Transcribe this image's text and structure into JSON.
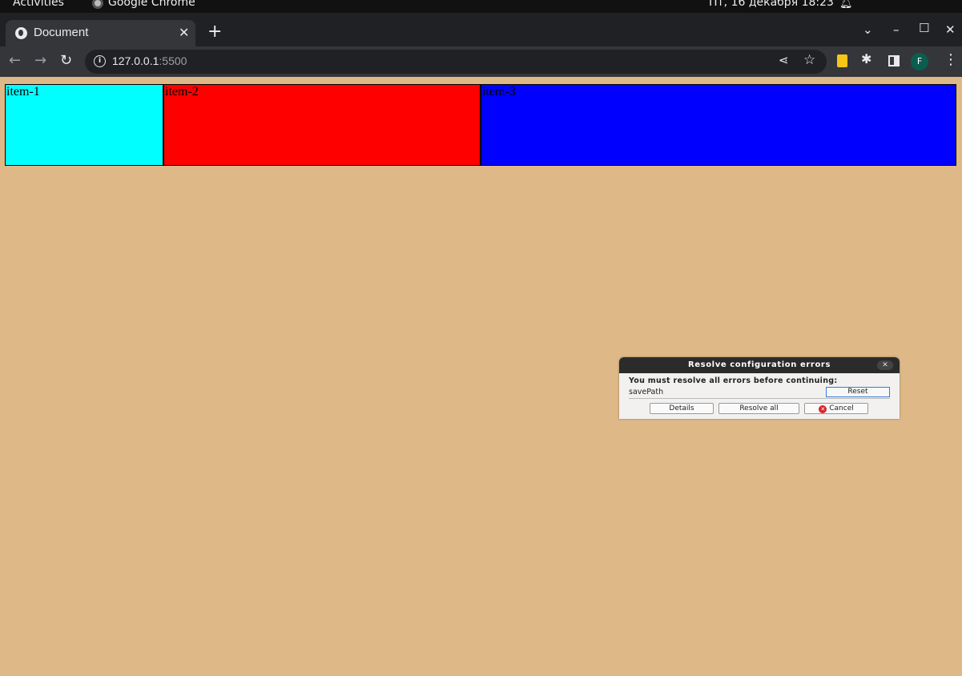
{
  "system_bar": {
    "activities": "Activities",
    "app_name": "Google Chrome",
    "clock": "Пт, 16 декабря  18:23"
  },
  "browser": {
    "tab_title": "Document",
    "url_host": "127.0.0.1",
    "url_port": ":5500",
    "profile_initial": "F"
  },
  "page": {
    "items": [
      {
        "label": "item-1",
        "color": "#00ffff"
      },
      {
        "label": "item-2",
        "color": "#ff0000"
      },
      {
        "label": "item-3",
        "color": "#0000ff"
      }
    ],
    "background": "#deb887"
  },
  "dialog": {
    "title": "Resolve configuration errors",
    "message": "You must resolve all errors before continuing:",
    "error_name": "savePath",
    "reset_label": "Reset",
    "details_label": "Details",
    "resolve_all_label": "Resolve all",
    "cancel_label": "Cancel"
  },
  "icons": [
    "chrome-icon",
    "notification-bell-icon",
    "globe-icon",
    "close-icon",
    "new-tab-icon",
    "back-icon",
    "forward-icon",
    "reload-icon",
    "info-icon",
    "share-icon",
    "bookmark-star-icon",
    "extension-notes-icon",
    "extensions-puzzle-icon",
    "side-panel-icon",
    "kebab-menu-icon",
    "cancel-icon"
  ]
}
